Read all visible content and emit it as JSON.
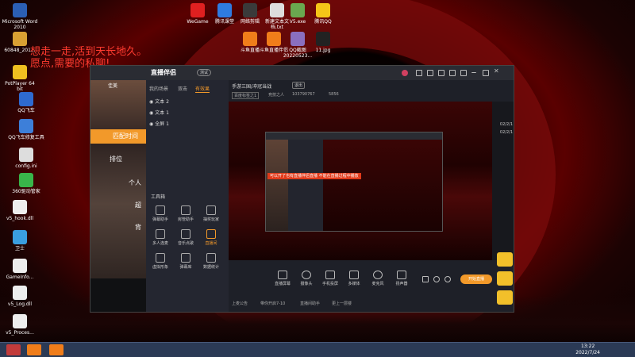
{
  "desktop": {
    "overlay_lines": [
      "想走一走,活到天长地久。",
      "愿点,需要的私聊!"
    ],
    "icons_left": [
      {
        "label": "Microsoft Word 2010"
      },
      {
        "label": "60848_201..."
      },
      {
        "label": "PotPlayer 64 bit"
      },
      {
        "label": "QQ飞车"
      },
      {
        "label": "QQ飞车修复工具"
      },
      {
        "label": "config.ini"
      },
      {
        "label": "360驱动管家"
      },
      {
        "label": "v5_hook.dll"
      },
      {
        "label": "卫士"
      },
      {
        "label": "GameInfo..."
      },
      {
        "label": "v5_Log.dll"
      },
      {
        "label": "v5_Proces..."
      }
    ],
    "icons_top": [
      {
        "label": "WeGame"
      },
      {
        "label": "腾讯课堂"
      },
      {
        "label": "网络剪辑"
      },
      {
        "label": "新建文本文档.txt"
      },
      {
        "label": "V5.exe"
      },
      {
        "label": "腾讯QQ"
      },
      {
        "label": "斗鱼直播"
      },
      {
        "label": "斗鱼直播伴侣"
      },
      {
        "label": "QQ截图20220523..."
      },
      {
        "label": "11.jpg"
      }
    ]
  },
  "app": {
    "logo_text": "直播伴侣",
    "version_tag": "测试",
    "left_panel": {
      "title": "佳美",
      "orange_banner": "匹配时间",
      "line1": "排位",
      "line2": "个人",
      "line3": "超",
      "line4": "背"
    },
    "scene_tabs": [
      "我的场景",
      "双击",
      "有效果"
    ],
    "scenes": [
      "文本 2",
      "文本 1",
      "全屏 1"
    ],
    "tools_title": "工具箱",
    "tools": [
      {
        "label": "弹幕助手",
        "hot": false
      },
      {
        "label": "房管助手",
        "hot": false
      },
      {
        "label": "抽奖玩家",
        "hot": false
      },
      {
        "label": "多人连麦",
        "hot": false
      },
      {
        "label": "音乐点歌",
        "hot": false
      },
      {
        "label": "直播间",
        "hot": true
      },
      {
        "label": "虚拟形象",
        "hot": false
      },
      {
        "label": "弹幕库",
        "hot": false
      },
      {
        "label": "数据统计",
        "hot": false
      }
    ],
    "stage_title": "手游三国/冲冠当战",
    "stage_tag": "退出",
    "stage_meta": [
      "百度标签之1",
      "竞技之人",
      "103790767",
      "5856"
    ],
    "inner_red_text": "可以开了也有直播伴侣直播 不能在直播过程中播放",
    "bottom_tools": [
      {
        "label": "直播屏幕"
      },
      {
        "label": "摄像头"
      },
      {
        "label": "手机投屏"
      },
      {
        "label": "多媒体"
      },
      {
        "label": "麦克风"
      },
      {
        "label": "扬声器"
      }
    ],
    "go_live": "开始直播",
    "status_items": [
      "上麦公告",
      "带你开启7-10",
      "直播间助手",
      "更上一层楼"
    ],
    "timestamps": [
      "02/2/1",
      "02/2/1"
    ],
    "colors": {
      "accent": "#f2992a",
      "red_banner": "#e03a1a"
    }
  },
  "taskbar": {
    "time": "13:22",
    "date": "2022/7/24"
  }
}
